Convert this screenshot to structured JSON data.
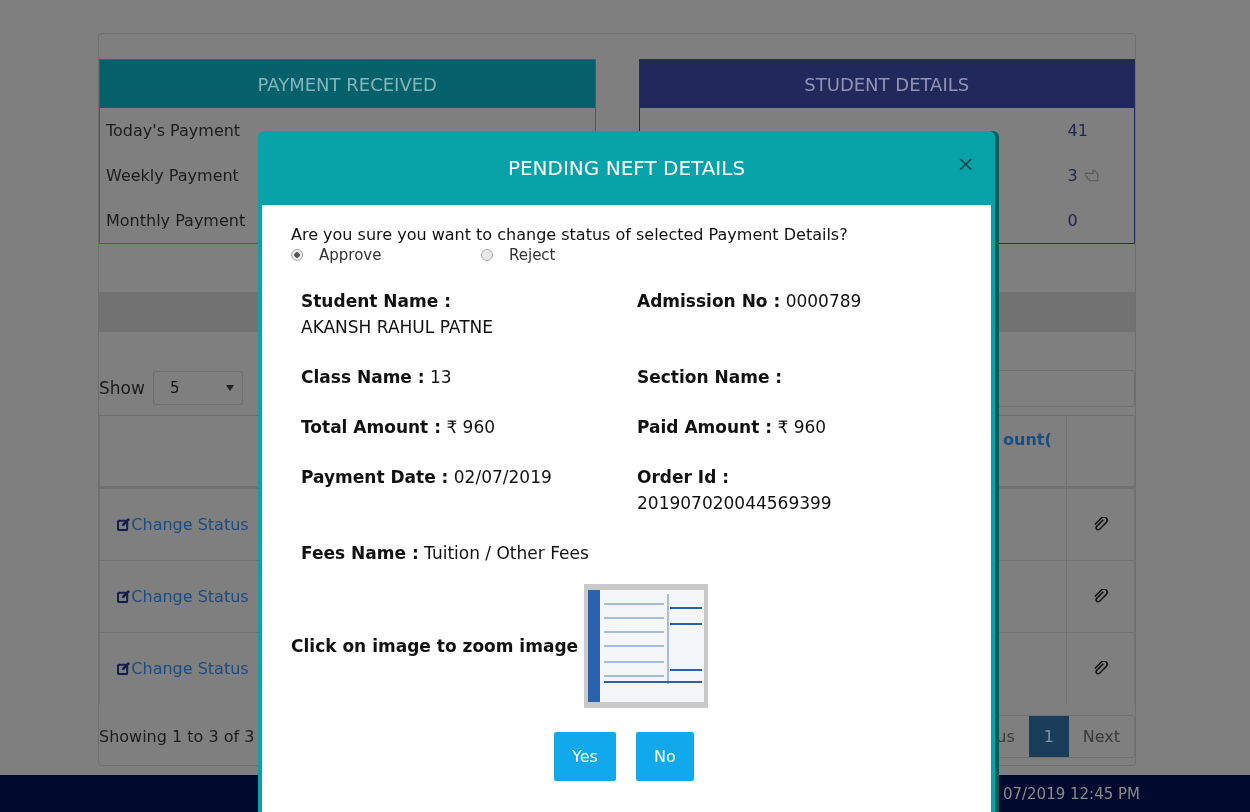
{
  "payment_received": {
    "title": "PAYMENT RECEIVED",
    "rows": [
      {
        "label": "Today's Payment"
      },
      {
        "label": "Weekly Payment"
      },
      {
        "label": "Monthly Payment"
      }
    ]
  },
  "student_details": {
    "title": "STUDENT DETAILS",
    "rows": [
      {
        "value": "41",
        "pointer_icon": false
      },
      {
        "value": "3",
        "pointer_icon": true
      },
      {
        "value": "0",
        "pointer_icon": false
      }
    ]
  },
  "show_entries": {
    "label": "Show",
    "value": "5"
  },
  "table": {
    "column_4": "ount(",
    "rows": [
      {
        "action": "Change Status"
      },
      {
        "action": "Change Status"
      },
      {
        "action": "Change Status"
      }
    ]
  },
  "showing": "Showing 1 to 3 of 3",
  "pagination": {
    "previous": "us",
    "pages": [
      {
        "label": "1",
        "selected": true
      }
    ],
    "next": "Next"
  },
  "footer": {
    "timestamp": "07/2019 12:45 PM"
  },
  "modal": {
    "title": "PENDING NEFT DETAILS",
    "close": "×",
    "question": "Are you sure you want to change status of selected Payment Details?",
    "options": [
      {
        "label": "Approve",
        "selected": true
      },
      {
        "label": "Reject",
        "selected": false
      }
    ],
    "fields": [
      {
        "label": "Student Name :",
        "value": "AKANSH RAHUL PATNE"
      },
      {
        "label": "Admission No :",
        "value": "0000789"
      },
      {
        "label": "Class Name :",
        "value": "13"
      },
      {
        "label": "Section Name :"
      },
      {
        "label": "Total Amount :",
        "value": "₹ 960"
      },
      {
        "label": "Paid Amount :",
        "value": "₹ 960"
      },
      {
        "label": "Payment Date :",
        "value": "02/07/2019"
      },
      {
        "label": "Order Id :",
        "value": "201907020044569399"
      },
      {
        "label": "Fees Name :",
        "value": "Tuition / Other Fees"
      }
    ],
    "image_caption": "Click on image to zoom image",
    "buttons": [
      "Yes",
      "No"
    ]
  }
}
